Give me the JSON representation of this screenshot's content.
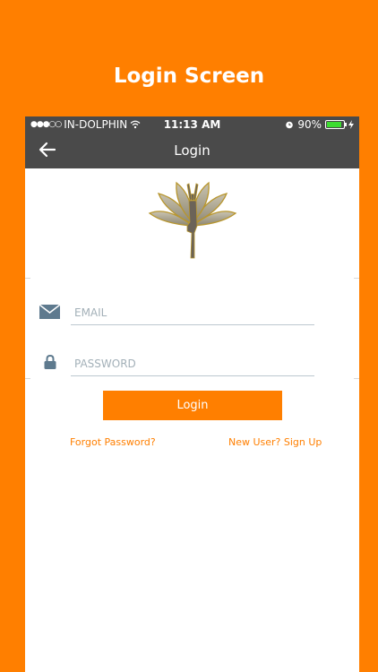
{
  "promo": {
    "title": "Login Screen"
  },
  "status_bar": {
    "carrier": "IN-DOLPHIN",
    "time": "11:13 AM",
    "battery": "90%",
    "battery_level": 0.9,
    "icons": [
      "signal-dots-icon",
      "wifi-icon",
      "alarm-icon",
      "battery-icon",
      "charging-icon"
    ]
  },
  "nav": {
    "title": "Login",
    "back_icon": "back-arrow-icon"
  },
  "logo": {
    "icon": "yoga-lotus-logo"
  },
  "form": {
    "email_placeholder": "EMAIL",
    "password_placeholder": "PASSWORD",
    "email_icon": "envelope-icon",
    "password_icon": "lock-icon",
    "login_label": "Login",
    "forgot_label": "Forgot Password?",
    "signup_label": "New User? Sign Up"
  },
  "colors": {
    "accent": "#FF7F00",
    "bar": "#4a4a4a",
    "field_line": "#bcc8d0"
  }
}
